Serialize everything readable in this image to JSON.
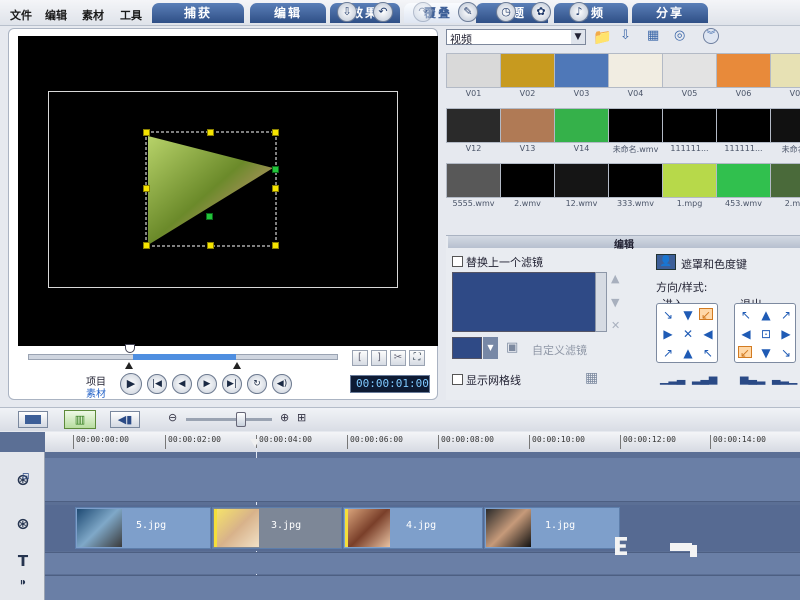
{
  "menu": [
    "文件",
    "编辑",
    "素材",
    "工具"
  ],
  "tabs": [
    "捕获",
    "编辑",
    "效果",
    "覆叠",
    "标题",
    "音频",
    "分享"
  ],
  "active_tab": "覆叠",
  "preview": {
    "mode_project": "项目",
    "mode_clip": "素材",
    "timecode": "00:00:01:00"
  },
  "library": {
    "category": "视频",
    "thumbnails": [
      {
        "label": "V01",
        "color": "#d9d9d9"
      },
      {
        "label": "V02",
        "color": "#c79a1f"
      },
      {
        "label": "V03",
        "color": "#4f78b8"
      },
      {
        "label": "V04",
        "color": "#f1ede2"
      },
      {
        "label": "V05",
        "color": "#e3e3e3"
      },
      {
        "label": "V06",
        "color": "#e88a3a"
      },
      {
        "label": "V07",
        "color": "#e7e1b4"
      },
      {
        "label": "V12",
        "color": "#2a2a2a"
      },
      {
        "label": "V13",
        "color": "#b07a55"
      },
      {
        "label": "V14",
        "color": "#35b14a"
      },
      {
        "label": "未命名.wmv",
        "color": "#000000"
      },
      {
        "label": "111111...",
        "color": "#000000"
      },
      {
        "label": "111111...",
        "color": "#000000"
      },
      {
        "label": "未命名...",
        "color": "#111111"
      },
      {
        "label": "5555.wmv",
        "color": "#585858"
      },
      {
        "label": "2.wmv",
        "color": "#000000"
      },
      {
        "label": "12.wmv",
        "color": "#151515"
      },
      {
        "label": "333.wmv",
        "color": "#000000"
      },
      {
        "label": "1.mpg",
        "color": "#b7d94a"
      },
      {
        "label": "453.wmv",
        "color": "#31c04e"
      },
      {
        "label": "2.mpg",
        "color": "#4a6a3a"
      }
    ]
  },
  "edit": {
    "header": "编辑",
    "replace_filter_label": "替换上一个滤镜",
    "custom_filter": "自定义滤镜",
    "show_grid": "显示网格线",
    "mask_chroma": "遮罩和色度键",
    "direction_style": "方向/样式:",
    "enter_label": "进入",
    "exit_label": "退出"
  },
  "timeline": {
    "ticks": [
      "00:00:00:00",
      "00:00:02:00",
      "00:00:04:00",
      "00:00:06:00",
      "00:00:08:00",
      "00:00:10:00",
      "00:00:12:00",
      "00:00:14:00"
    ],
    "clips": [
      "5.jpg",
      "3.jpg",
      "4.jpg",
      "1.jpg"
    ]
  },
  "colors": {
    "tab_active_text": "#3d5f98",
    "tab_bg": "#2f4f86",
    "timeline_bg": "#5b6f95",
    "clip_bg": "#7e9fcb",
    "timecode_text": "#7fc9ff"
  }
}
